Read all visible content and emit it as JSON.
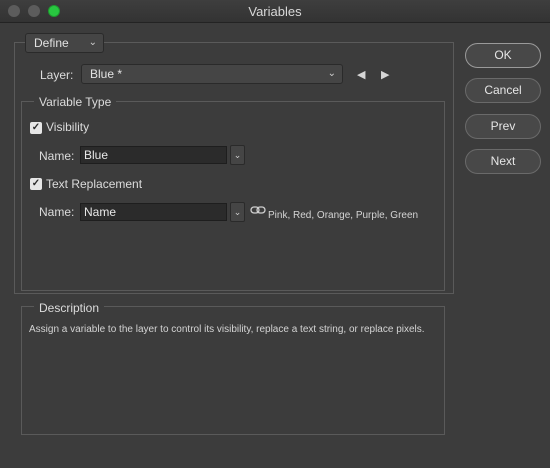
{
  "window": {
    "title": "Variables"
  },
  "mode": {
    "selected": "Define"
  },
  "layer": {
    "label": "Layer:",
    "selected": "Blue *"
  },
  "variable_type": {
    "legend": "Variable Type",
    "visibility": {
      "label": "Visibility",
      "checked": true,
      "name_label": "Name:",
      "name_value": "Blue"
    },
    "text_replacement": {
      "label": "Text Replacement",
      "checked": true,
      "name_label": "Name:",
      "name_value": "Name",
      "linked_values": "Pink, Red, Orange, Purple, Green"
    }
  },
  "description": {
    "legend": "Description",
    "text": "Assign a variable to the layer to control its visibility, replace a text string, or replace pixels."
  },
  "buttons": {
    "ok": "OK",
    "cancel": "Cancel",
    "prev": "Prev",
    "next": "Next"
  },
  "icons": {
    "prev_layer": "triangle-left-icon",
    "next_layer": "triangle-right-icon",
    "link": "link-icon",
    "caret": "chevron-down-icon"
  },
  "colors": {
    "background": "#3c3c3c",
    "field": "#2b2b2b",
    "maximize": "#28c840"
  }
}
